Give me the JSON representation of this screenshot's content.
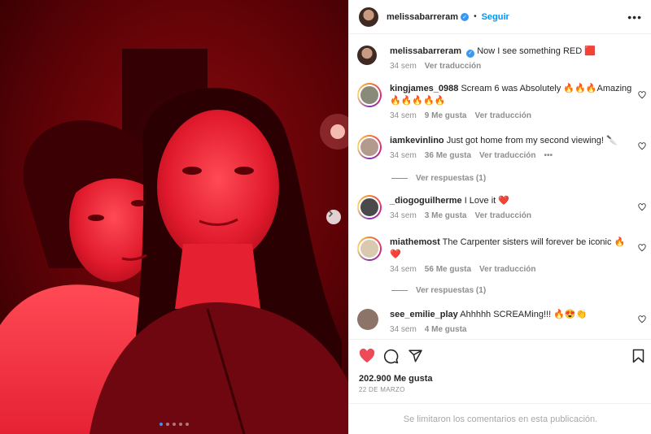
{
  "post": {
    "username": "melissabarreram",
    "follow_label": "Seguir",
    "separator": "•",
    "more_icon": "more-horizontal-icon",
    "verified_icon": "verified-check-icon"
  },
  "caption": {
    "username": "melissabarreram",
    "text": "Now I see something RED 🟥",
    "time": "34 sem",
    "translate": "Ver traducción"
  },
  "comments": [
    {
      "username": "kingjames_0988",
      "text": "Scream 6 was Absolutely 🔥🔥🔥Amazing 🔥🔥🔥🔥🔥",
      "time": "34 sem",
      "likes": "9 Me gusta",
      "translate": "Ver traducción"
    },
    {
      "username": "iamkevinlino",
      "text": "Just got home from my second viewing! 🔪",
      "time": "34 sem",
      "likes": "36 Me gusta",
      "translate": "Ver traducción",
      "more": "•••",
      "replies": "Ver respuestas (1)"
    },
    {
      "username": "_diogoguilherme",
      "text": "I Love it ❤️",
      "time": "34 sem",
      "likes": "3 Me gusta",
      "translate": "Ver traducción"
    },
    {
      "username": "miathemost",
      "text": "The Carpenter sisters will forever be iconic 🔥❤️",
      "time": "34 sem",
      "likes": "56 Me gusta",
      "translate": "Ver traducción",
      "replies": "Ver respuestas (1)"
    },
    {
      "username": "see_emilie_play",
      "text": "Ahhhhh SCREAMing!!! 🔥😍👏",
      "time": "34 sem",
      "likes": "4 Me gusta"
    }
  ],
  "actions": {
    "like_icon": "heart-filled-icon",
    "comment_icon": "comment-icon",
    "share_icon": "send-icon",
    "save_icon": "bookmark-icon",
    "likes_count": "202.900 Me gusta",
    "date": "22 DE MARZO"
  },
  "footer": {
    "text": "Se limitaron los comentarios en esta publicación."
  },
  "carousel": {
    "total_slides": 5,
    "active_slide": 1,
    "next_icon": "chevron-right-icon"
  },
  "colors": {
    "accent": "#0095f6",
    "like_red": "#ed4956",
    "photo_red": "#d8142a"
  }
}
